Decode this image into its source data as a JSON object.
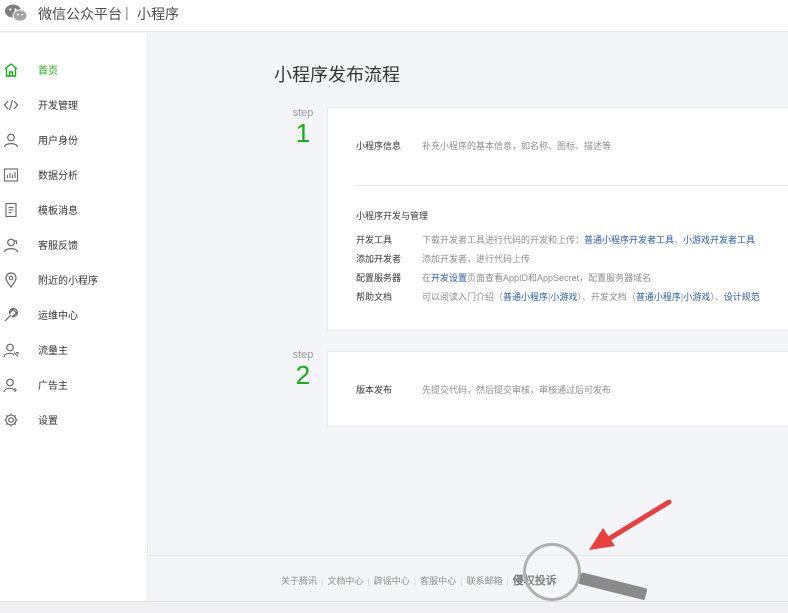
{
  "header": {
    "title": "微信公众平台",
    "separator": "|",
    "subtitle": "小程序"
  },
  "sidebar": {
    "items": [
      {
        "label": "首页",
        "icon": "home-icon"
      },
      {
        "label": "开发管理",
        "icon": "code-icon"
      },
      {
        "label": "用户身份",
        "icon": "user-icon"
      },
      {
        "label": "数据分析",
        "icon": "chart-icon"
      },
      {
        "label": "模板消息",
        "icon": "template-icon"
      },
      {
        "label": "客服反馈",
        "icon": "service-icon"
      },
      {
        "label": "附近的小程序",
        "icon": "location-icon"
      },
      {
        "label": "运维中心",
        "icon": "wrench-icon"
      },
      {
        "label": "流量主",
        "icon": "traffic-icon"
      },
      {
        "label": "广告主",
        "icon": "advertiser-icon"
      },
      {
        "label": "设置",
        "icon": "gear-icon"
      }
    ]
  },
  "main": {
    "title": "小程序发布流程",
    "steps": [
      {
        "word": "step",
        "num": "1"
      },
      {
        "word": "step",
        "num": "2"
      }
    ],
    "card1": {
      "info_key": "小程序信息",
      "info_value": "补充小程序的基本信息，如名称、图标、描述等",
      "dev_heading": "小程序开发与管理",
      "rows": [
        {
          "key": "开发工具",
          "text": "下载开发者工具进行代码的开发和上传：",
          "link1": "普通小程序开发者工具",
          "mid": "、",
          "link2": "小游戏开发者工具"
        },
        {
          "key": "添加开发者",
          "text": "添加开发者，进行代码上传"
        },
        {
          "key": "配置服务器",
          "pre": "在",
          "link": "开发设置",
          "text": "页面查看AppID和AppSecret，配置服务器域名"
        },
        {
          "key": "帮助文档",
          "t1": "可以阅读入门介绍（",
          "l1": "普通小程序",
          "s1": "|",
          "l2": "小游戏",
          "t2": "）、开发文档（",
          "l3": "普通小程序",
          "s2": "|",
          "l4": "小游戏",
          "t3": "）、",
          "l5": "设计规范"
        }
      ]
    },
    "card2": {
      "key": "版本发布",
      "value": "先提交代码，然后提交审核，审核通过后可发布"
    }
  },
  "footer": {
    "links": [
      "关于腾讯",
      "文档中心",
      "辟谣中心",
      "客服中心",
      "联系邮箱",
      "侵权投诉"
    ]
  },
  "colors": {
    "accent": "#1aad19",
    "link": "#2b5a9e",
    "annotation_arrow": "#e8403f"
  }
}
